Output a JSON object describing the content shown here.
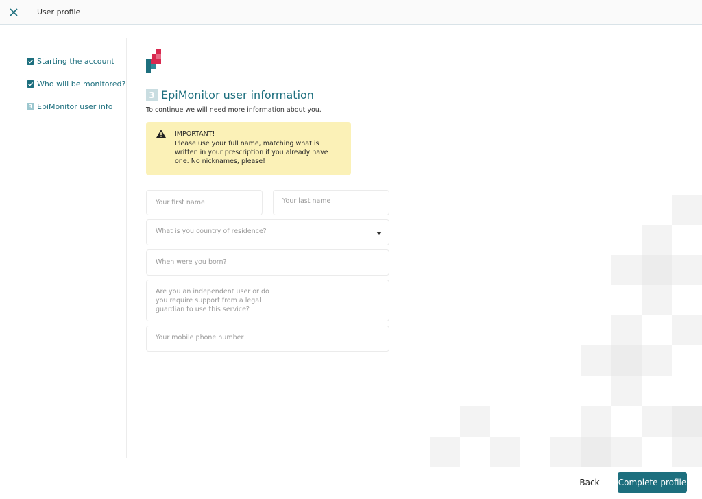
{
  "header": {
    "title": "User profile",
    "close_icon": "close-icon"
  },
  "sidebar": {
    "steps": [
      {
        "label": "Starting the account",
        "state": "done",
        "icon": "check-icon"
      },
      {
        "label": "Who will be monitored?",
        "state": "done",
        "icon": "check-icon"
      },
      {
        "number": "3",
        "label": "EpiMonitor user info",
        "state": "current"
      }
    ]
  },
  "main": {
    "step_number": "3",
    "title": "EpiMonitor user information",
    "intro": "To continue we will need more information about you.",
    "alert": {
      "icon": "warning-icon",
      "title": "IMPORTANT!",
      "body": "Please use your full name, matching what is written in your prescription if you already have one. No nicknames, please!"
    },
    "fields": {
      "first_name": {
        "placeholder": "Your first name",
        "value": ""
      },
      "last_name": {
        "placeholder": "Your last name",
        "value": ""
      },
      "country": {
        "placeholder": "What is you country of residence?",
        "value": ""
      },
      "birth": {
        "placeholder": "When were you born?",
        "value": ""
      },
      "guardian": {
        "placeholder": "Are you an independent user or do you require support from a legal guardian to use this service?",
        "value": ""
      },
      "phone": {
        "placeholder": "Your mobile phone number",
        "value": ""
      }
    }
  },
  "footer": {
    "back_label": "Back",
    "complete_label": "Complete profile"
  },
  "colors": {
    "accent": "#1d6f7e",
    "alert_bg": "#fbf1b7",
    "logo_red": "#d8294f"
  }
}
